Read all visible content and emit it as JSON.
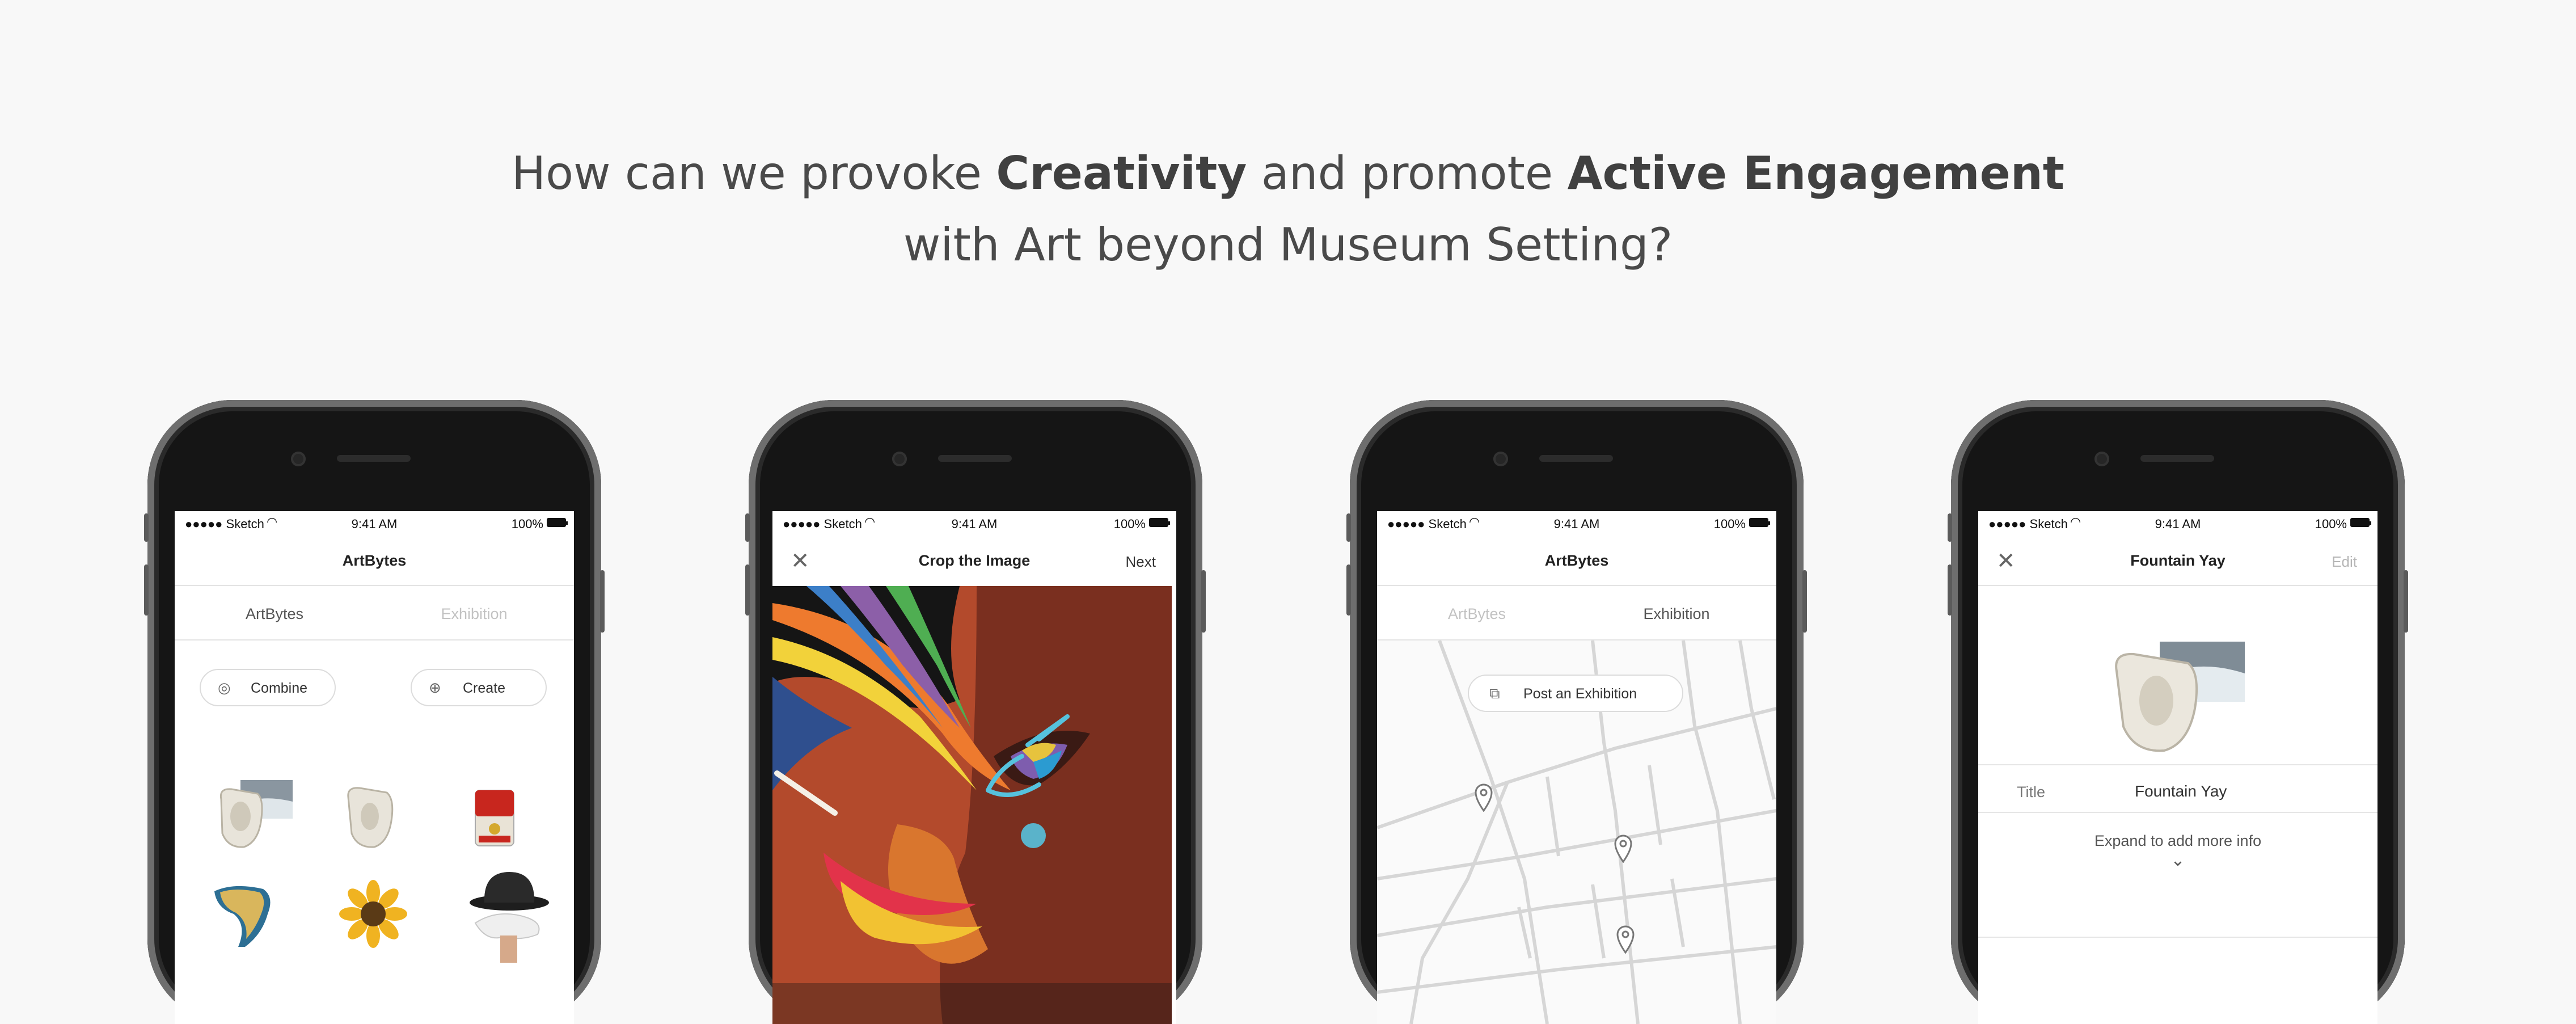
{
  "headline": {
    "line1_a": "How can we provoke ",
    "line1_b": "Creativity",
    "line1_c": " and promote ",
    "line1_d": "Active Engagement",
    "line2": "with Art beyond Museum Setting?"
  },
  "status": {
    "carrier": "●●●●● Sketch",
    "time": "9:41 AM",
    "battery": "100%"
  },
  "screen1": {
    "title": "ArtBytes",
    "tabs": [
      "ArtBytes",
      "Exhibition"
    ],
    "combine_label": "Combine",
    "create_label": "Create",
    "thumbs": [
      "urinal-with-seascape",
      "urinal",
      "soup-can",
      "melting-clock",
      "sunflower",
      "bowler-hat-dove"
    ]
  },
  "screen2": {
    "title": "Crop the Image",
    "next_label": "Next"
  },
  "screen3": {
    "title": "ArtBytes",
    "tabs": [
      "ArtBytes",
      "Exhibition"
    ],
    "post_label": "Post an Exhibition"
  },
  "screen4": {
    "title": "Fountain Yay",
    "edit_label": "Edit",
    "field_label": "Title",
    "field_value": "Fountain Yay",
    "expand_label": "Expand to add more info"
  },
  "colors": {
    "background": "#f8f8f8",
    "phone": "#151515",
    "accent": "#4fb6d8"
  },
  "icons": [
    "wifi-icon",
    "battery-icon",
    "close-icon",
    "combine-icon",
    "plus-circle-icon",
    "map-pin-icon",
    "post-icon",
    "chevron-down-icon"
  ]
}
